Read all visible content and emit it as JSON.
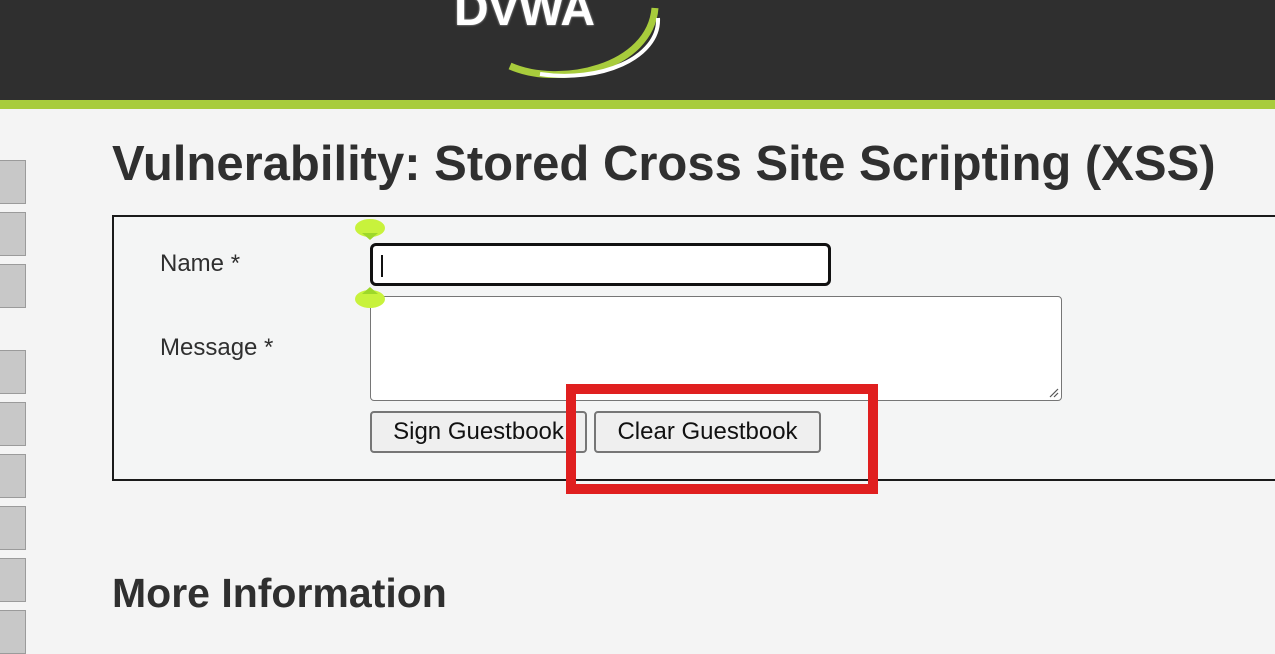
{
  "header": {
    "logo_text": "DVWA",
    "background": "#2f2f2f",
    "accent": "#a8cc3c"
  },
  "page": {
    "title": "Vulnerability: Stored Cross Site Scripting (XSS)",
    "section_title": "More Information"
  },
  "form": {
    "name_label": "Name *",
    "name_value": "",
    "message_label": "Message *",
    "message_value": "",
    "sign_button_label": "Sign Guestbook",
    "clear_button_label": "Clear Guestbook"
  },
  "annotation": {
    "highlight_color": "#e01f1f",
    "marker_color": "#c8f23c",
    "highlight_target": "clear-guestbook-button"
  },
  "sidebar": {
    "tab_count_visible": 9
  }
}
